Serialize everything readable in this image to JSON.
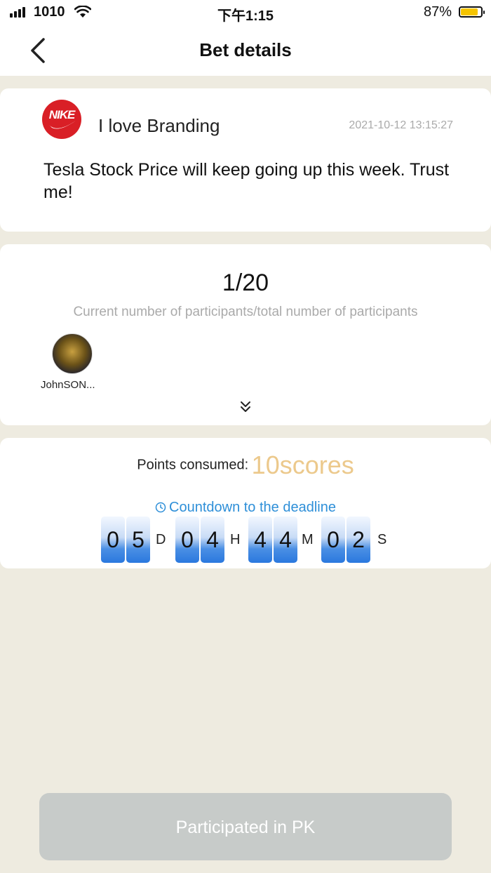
{
  "status_bar": {
    "carrier": "1010",
    "time": "下午1:15",
    "battery_percent": "87%",
    "battery_level": 0.87
  },
  "nav": {
    "title": "Bet details",
    "back_icon": "chevron-left-icon"
  },
  "post": {
    "username": "I love Branding",
    "logo_text": "NIKE",
    "timestamp": "2021-10-12 13:15:27",
    "content": "Tesla Stock Price will keep going up this week. Trust me!"
  },
  "participants": {
    "count": "1/20",
    "description": "Current number of participants/total number of participants",
    "members": [
      {
        "name": "JohnSON..."
      }
    ],
    "expand_icon": "double-chevron-down-icon"
  },
  "points": {
    "label": "Points consumed:",
    "value": "10scores"
  },
  "countdown": {
    "title": "Countdown to the deadline",
    "digits": [
      "0",
      "5",
      "0",
      "4",
      "4",
      "4",
      "0",
      "2"
    ],
    "units": [
      "D",
      "H",
      "M",
      "S"
    ]
  },
  "action": {
    "button_label": "Participated in PK"
  },
  "colors": {
    "background": "#eeebe0",
    "accent_blue": "#2e8fd8",
    "points_gold": "#ecc98c",
    "battery": "#f5c400",
    "button_disabled": "#c7cbc9"
  }
}
